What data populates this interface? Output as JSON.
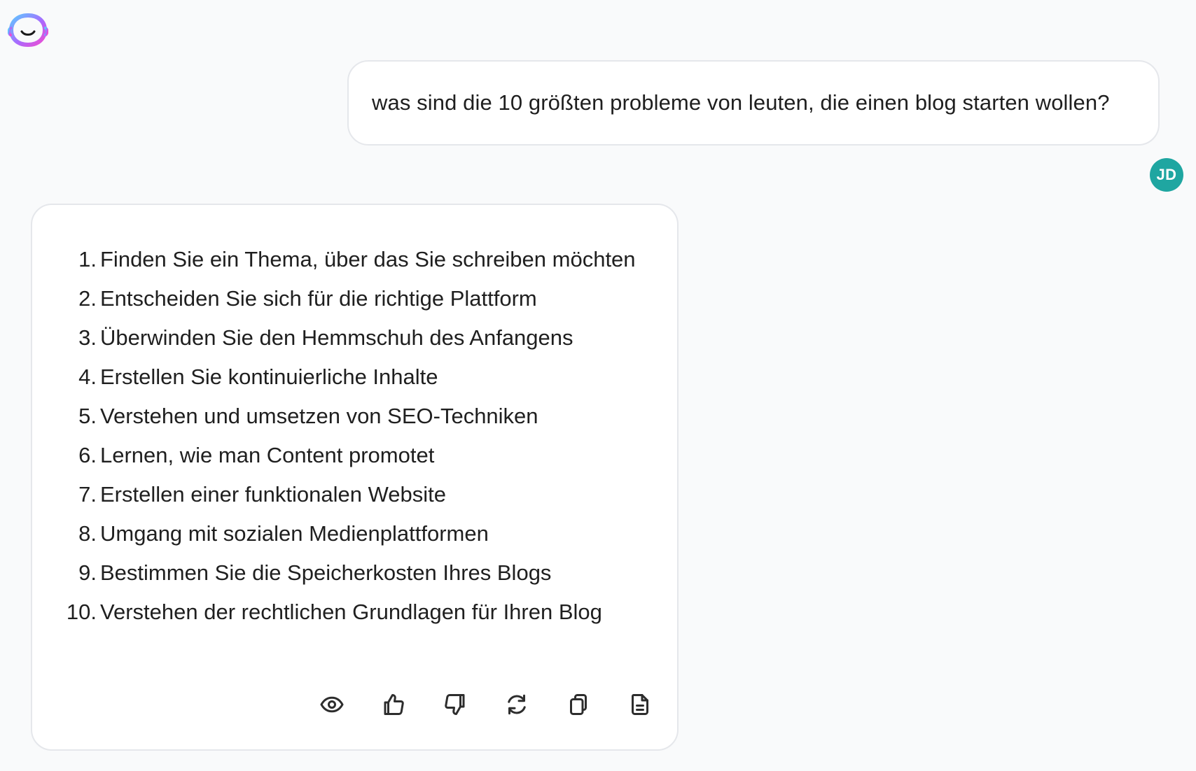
{
  "conversation": {
    "user_message": "was sind die 10 größten probleme von leuten, die einen blog starten wollen?",
    "user_avatar_initials": "JD",
    "assistant_answer": [
      {
        "num": "1.",
        "text": "Finden Sie ein Thema, über das Sie schreiben möchten"
      },
      {
        "num": "2.",
        "text": "Entscheiden Sie sich für die richtige Plattform"
      },
      {
        "num": "3.",
        "text": "Überwinden Sie den Hemmschuh des Anfangens"
      },
      {
        "num": "4.",
        "text": "Erstellen Sie kontinuierliche Inhalte"
      },
      {
        "num": "5.",
        "text": "Verstehen und umsetzen von SEO-Techniken"
      },
      {
        "num": "6.",
        "text": "Lernen, wie man Content promotet"
      },
      {
        "num": "7.",
        "text": "Erstellen einer funktionalen Website"
      },
      {
        "num": "8.",
        "text": "Umgang mit sozialen Medienplattformen"
      },
      {
        "num": "9.",
        "text": "Bestimmen Sie die Speicherkosten Ihres Blogs"
      },
      {
        "num": "10.",
        "text": "Verstehen der rechtlichen Grundlagen für Ihren Blog"
      }
    ]
  },
  "action_icons": [
    "eye-icon",
    "thumbs-up-icon",
    "thumbs-down-icon",
    "regenerate-icon",
    "copy-icon",
    "document-icon"
  ],
  "colors": {
    "background": "#f9fafb",
    "bubble": "#ffffff",
    "bubble_border": "#e5e7eb",
    "avatar": "#1fa6a1",
    "logo_gradient_start": "#5ec8ff",
    "logo_gradient_end": "#f04bd0"
  }
}
